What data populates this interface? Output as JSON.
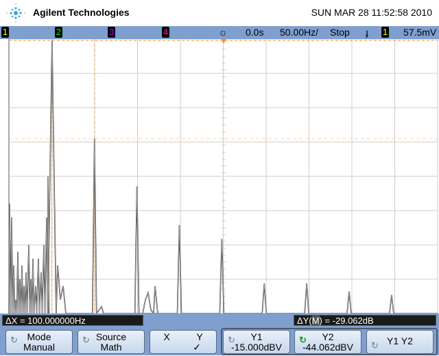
{
  "header": {
    "brand": "Agilent Technologies",
    "datetime": "SUN MAR 28 11:52:58 2010"
  },
  "status_bar": {
    "channels": [
      {
        "label": "1",
        "color": "#ffff00"
      },
      {
        "label": "2",
        "color": "#00ff00"
      },
      {
        "label": "3",
        "color": "#c000ff"
      },
      {
        "label": "4",
        "color": "#ff2080"
      }
    ],
    "delay": "0.0s",
    "timebase": "50.00Hz/",
    "run_state": "Stop",
    "trigger_source": "1",
    "trigger_level": "57.5mV"
  },
  "readouts": {
    "delta_x": "ΔX = 100.000000Hz",
    "delta_y_prefix": "ΔY(",
    "delta_y_source": "M",
    "delta_y_suffix": ") = -29.062dB"
  },
  "softkeys": [
    {
      "top": "Mode",
      "bottom": "Manual"
    },
    {
      "top": "Source",
      "bottom": "Math"
    },
    {
      "top": "X",
      "top2": "Y",
      "bottom": "✓"
    },
    {
      "top": "Y1",
      "bottom": "-15.000dBV"
    },
    {
      "top": "Y2",
      "bottom": "-44.062dBV"
    },
    {
      "top": "Y1 Y2",
      "bottom": ""
    }
  ],
  "trace": {
    "unit": "dBV",
    "peaks_hz": [
      100,
      200,
      300,
      400,
      500,
      600,
      700,
      800,
      900
    ],
    "peaks_dbv": [
      -15,
      -44,
      -58.2,
      -69.6,
      -73.7,
      -86.9,
      -86.9,
      -89.3,
      -90.3
    ],
    "cursor_y1_dbv": -15,
    "cursor_y2_dbv": -44.062,
    "cursor_x_hz": [
      100,
      200
    ]
  },
  "colors": {
    "bar": "#7f9fcf",
    "cursor": "#ff9020",
    "trace": "#808080"
  }
}
